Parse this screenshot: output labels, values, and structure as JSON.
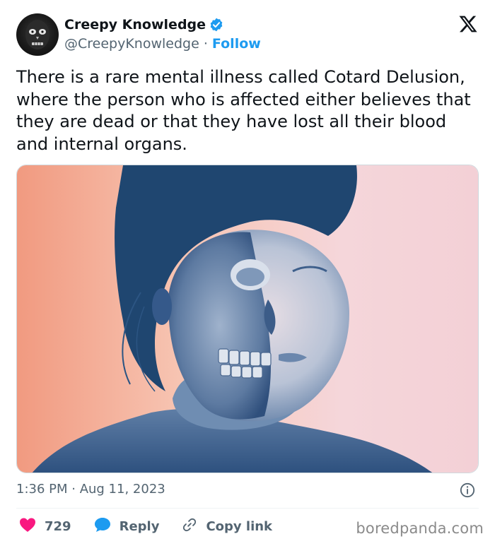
{
  "author": {
    "name": "Creepy Knowledge",
    "handle": "@CreepyKnowledge",
    "separator": " · ",
    "follow_label": "Follow",
    "verified": true
  },
  "icons": {
    "platform": "x-logo-icon",
    "verified": "verified-badge-icon",
    "info": "info-icon",
    "like": "heart-icon",
    "reply": "reply-bubble-icon",
    "copy": "link-icon"
  },
  "tweet": {
    "text": "There is a rare mental illness called Cotard Delusion, where the person who is affected either believes that they are dead or that they have lost all their blood and internal organs.",
    "timestamp": "1:36 PM · Aug 11, 2023"
  },
  "actions": {
    "like_count": "729",
    "reply_label": "Reply",
    "copy_label": "Copy link"
  },
  "watermark": "boredpanda.com",
  "colors": {
    "accent": "#1d9bf0",
    "like": "#f91880",
    "muted": "#536471",
    "text": "#0f1419"
  }
}
